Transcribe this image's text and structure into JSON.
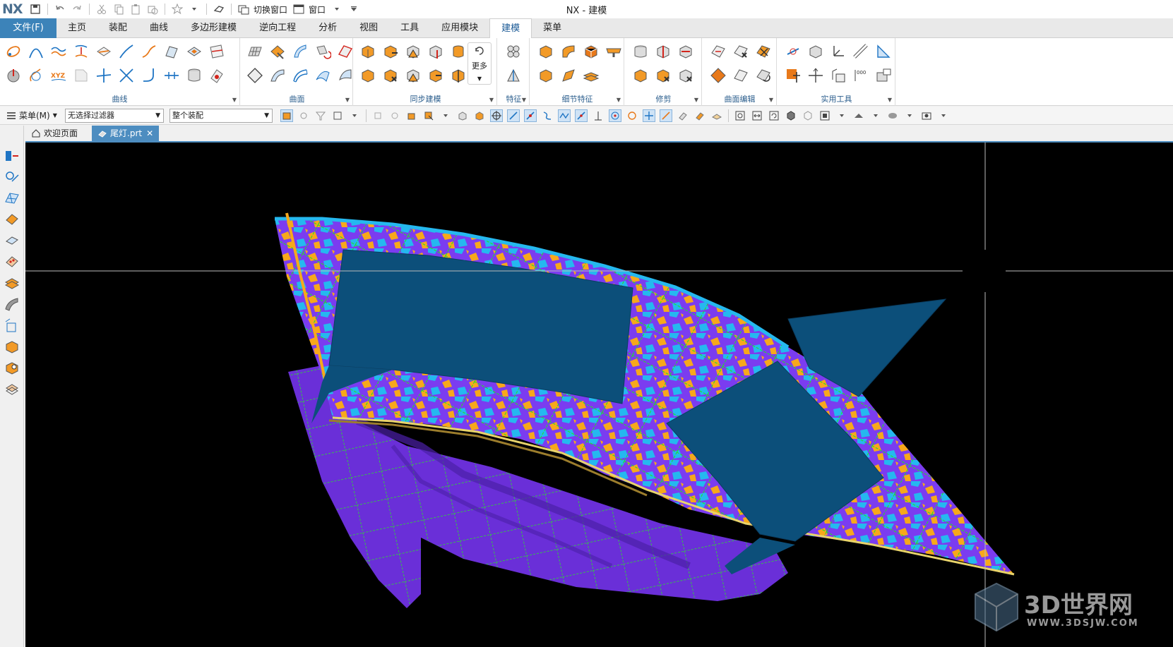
{
  "app": {
    "logo": "NX",
    "window_title": "NX - 建模",
    "switch_window_label": "切换窗口",
    "window_label": "窗口"
  },
  "tabs": {
    "file": "文件(F)",
    "items": [
      "主页",
      "装配",
      "曲线",
      "多边形建模",
      "逆向工程",
      "分析",
      "视图",
      "工具",
      "应用模块",
      "建模",
      "菜单"
    ],
    "active": "建模"
  },
  "ribbon": {
    "groups": [
      "曲线",
      "曲面",
      "同步建模",
      "特征",
      "细节特征",
      "修剪",
      "曲面编辑",
      "实用工具"
    ],
    "more_label": "更多",
    "xyz_label": "XYZ"
  },
  "cmdbar": {
    "menu_label": "菜单(M)",
    "filter_value": "无选择过滤器",
    "assembly_value": "整个装配"
  },
  "doc_tabs": {
    "welcome": "欢迎页面",
    "part": "尾灯.prt"
  },
  "watermark": {
    "name": "3D世界网",
    "url": "WWW.3DSJW.COM"
  },
  "colors": {
    "accent": "#3c83b9",
    "viewport_bg": "#000000",
    "surface_blue": "#0c4f7a",
    "mesh_purple": "#7b3cf0",
    "deviation_cyan": "#25b8ef",
    "deviation_orange": "#f7a81b",
    "grid_green": "#22e02a"
  }
}
